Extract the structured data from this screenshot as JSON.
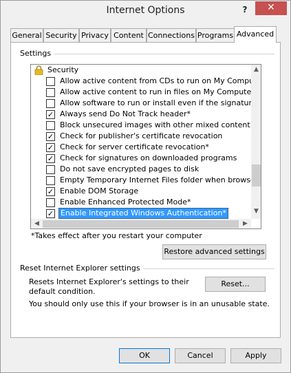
{
  "window": {
    "title": "Internet Options",
    "help_label": "?",
    "close_label": "✕"
  },
  "tabs": [
    {
      "label": "General"
    },
    {
      "label": "Security"
    },
    {
      "label": "Privacy"
    },
    {
      "label": "Content"
    },
    {
      "label": "Connections"
    },
    {
      "label": "Programs"
    },
    {
      "label": "Advanced"
    }
  ],
  "active_tab": "Advanced",
  "settings": {
    "group_label": "Settings",
    "category": {
      "label": "Security",
      "icon": "lock-icon"
    },
    "items": [
      {
        "label": "Allow active content from CDs to run on My Computer*",
        "checked": false,
        "checkmark": ""
      },
      {
        "label": "Allow active content to run in files on My Computer*",
        "checked": false,
        "checkmark": ""
      },
      {
        "label": "Allow software to run or install even if the signature is inva",
        "checked": false,
        "checkmark": ""
      },
      {
        "label": "Always send Do Not Track header*",
        "checked": true,
        "checkmark": "✓"
      },
      {
        "label": "Block unsecured images with other mixed content",
        "checked": false,
        "checkmark": ""
      },
      {
        "label": "Check for publisher's certificate revocation",
        "checked": true,
        "checkmark": "✓"
      },
      {
        "label": "Check for server certificate revocation*",
        "checked": true,
        "checkmark": "✓"
      },
      {
        "label": "Check for signatures on downloaded programs",
        "checked": true,
        "checkmark": "✓"
      },
      {
        "label": "Do not save encrypted pages to disk",
        "checked": false,
        "checkmark": ""
      },
      {
        "label": "Empty Temporary Internet Files folder when browser is clo",
        "checked": false,
        "checkmark": ""
      },
      {
        "label": "Enable DOM Storage",
        "checked": true,
        "checkmark": "✓"
      },
      {
        "label": "Enable Enhanced Protected Mode*",
        "checked": false,
        "checkmark": ""
      },
      {
        "label": "Enable Integrated Windows Authentication*",
        "checked": true,
        "checkmark": "✓",
        "selected": true
      }
    ],
    "scroll_up": "▲",
    "scroll_down": "▼",
    "scroll_left": "◀",
    "scroll_right": "▶",
    "note": "*Takes effect after you restart your computer",
    "restore_button": "Restore advanced settings"
  },
  "reset": {
    "group_label": "Reset Internet Explorer settings",
    "description": "Resets Internet Explorer's settings to their default condition.",
    "button": "Reset...",
    "warning": "You should only use this if your browser is in an unusable state."
  },
  "footer": {
    "ok": "OK",
    "cancel": "Cancel",
    "apply": "Apply"
  }
}
